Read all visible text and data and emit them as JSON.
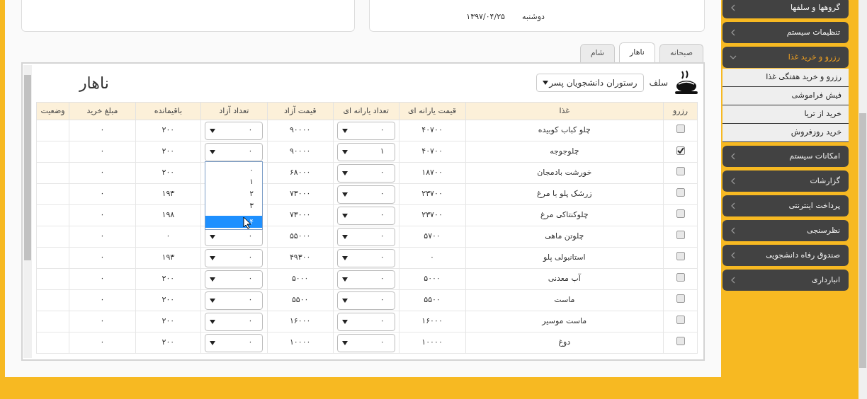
{
  "top_card": {
    "weekday": "دوشنبه",
    "date": "۱۳۹۷/۰۴/۲۵"
  },
  "tabs": [
    {
      "label": "صبحانه",
      "selected": false
    },
    {
      "label": "ناهار",
      "selected": true
    },
    {
      "label": "شام",
      "selected": false
    }
  ],
  "panel": {
    "title": "ناهار",
    "self_label": "سلف",
    "self_select": "رستوران دانشجویان پسر"
  },
  "table": {
    "columns": [
      "رزرو",
      "غذا",
      "قیمت یارانه ای",
      "تعداد یارانه ای",
      "قیمت آزاد",
      "تعداد آزاد",
      "باقیمانده",
      "مبلغ خرید",
      "وضعیت"
    ],
    "rows": [
      {
        "checked": false,
        "food": "چلو کباب کوبیده",
        "subsidy_price": "۴۰۷۰۰",
        "subsidy_qty": "۰",
        "free_price": "۹۰۰۰۰",
        "free_qty": "۰",
        "remaining": "۲۰۰",
        "amount": "۰"
      },
      {
        "checked": true,
        "food": "چلوجوجه",
        "subsidy_price": "۴۰۷۰۰",
        "subsidy_qty": "۱",
        "free_price": "۹۰۰۰۰",
        "free_qty": "۰",
        "remaining": "۲۰۰",
        "amount": "۰",
        "free_qty_options": [
          {
            "label": "۰",
            "selected": false
          },
          {
            "label": "۱",
            "selected": false
          },
          {
            "label": "۲",
            "selected": false
          },
          {
            "label": "۳",
            "selected": false
          },
          {
            "label": "۴",
            "selected": true
          }
        ]
      },
      {
        "checked": false,
        "food": "خورشت بادمجان",
        "subsidy_price": "۱۸۷۰۰",
        "subsidy_qty": "۰",
        "free_price": "۶۸۰۰۰",
        "remaining": "۲۰۰",
        "amount": "۰"
      },
      {
        "checked": false,
        "food": "زرشک پلو با مرغ",
        "subsidy_price": "۲۳۷۰۰",
        "subsidy_qty": "۰",
        "free_price": "۷۳۰۰۰",
        "remaining": "۱۹۳",
        "amount": "۰"
      },
      {
        "checked": false,
        "food": "چلوکنتاکی مرغ",
        "subsidy_price": "۲۳۷۰۰",
        "subsidy_qty": "۰",
        "free_price": "۷۳۰۰۰",
        "remaining": "۱۹۸",
        "amount": "۰"
      },
      {
        "checked": false,
        "food": "چلوتن ماهی",
        "subsidy_price": "۵۷۰۰",
        "subsidy_qty": "۰",
        "free_price": "۵۵۰۰۰",
        "free_qty": "۰",
        "remaining": "۰",
        "amount": "۰"
      },
      {
        "checked": false,
        "food": "استانبولی پلو",
        "subsidy_price": "۰",
        "subsidy_qty": "۰",
        "free_price": "۴۹۳۰۰",
        "free_qty": "۰",
        "remaining": "۱۹۳",
        "amount": "۰"
      },
      {
        "checked": false,
        "food": "آب معدنی",
        "subsidy_price": "۵۰۰۰",
        "subsidy_qty": "۰",
        "free_price": "۵۰۰۰",
        "free_qty": "۰",
        "remaining": "۲۰۰",
        "amount": "۰"
      },
      {
        "checked": false,
        "food": "ماست",
        "subsidy_price": "۵۵۰۰",
        "subsidy_qty": "۰",
        "free_price": "۵۵۰۰",
        "free_qty": "۰",
        "remaining": "۲۰۰",
        "amount": "۰"
      },
      {
        "checked": false,
        "food": "ماست موسیر",
        "subsidy_price": "۱۶۰۰۰",
        "subsidy_qty": "۰",
        "free_price": "۱۶۰۰۰",
        "free_qty": "۰",
        "remaining": "۲۰۰",
        "amount": "۰"
      },
      {
        "checked": false,
        "food": "دوغ",
        "subsidy_price": "۱۰۰۰۰",
        "subsidy_qty": "۰",
        "free_price": "۱۰۰۰۰",
        "free_qty": "۰",
        "remaining": "۲۰۰",
        "amount": "۰"
      }
    ]
  },
  "sidebar": {
    "items": [
      {
        "label": "گروهها و سلفها",
        "expanded": false
      },
      {
        "label": "تنظیمات سیستم",
        "expanded": false
      },
      {
        "label": "رزرو و خرید غذا",
        "expanded": true,
        "children": [
          {
            "label": "رزرو و خرید هفتگی غذا"
          },
          {
            "label": "فیش فراموشی"
          },
          {
            "label": "خرید از تریا"
          },
          {
            "label": "خرید روزفروش"
          }
        ]
      },
      {
        "label": "امکانات سیستم",
        "expanded": false
      },
      {
        "label": "گزارشات",
        "expanded": false
      },
      {
        "label": "پرداخت اینترنتی",
        "expanded": false
      },
      {
        "label": "نظرسنجی",
        "expanded": false
      },
      {
        "label": "صندوق رفاه دانشجویی",
        "expanded": false
      },
      {
        "label": "انبارداری",
        "expanded": false
      }
    ]
  }
}
